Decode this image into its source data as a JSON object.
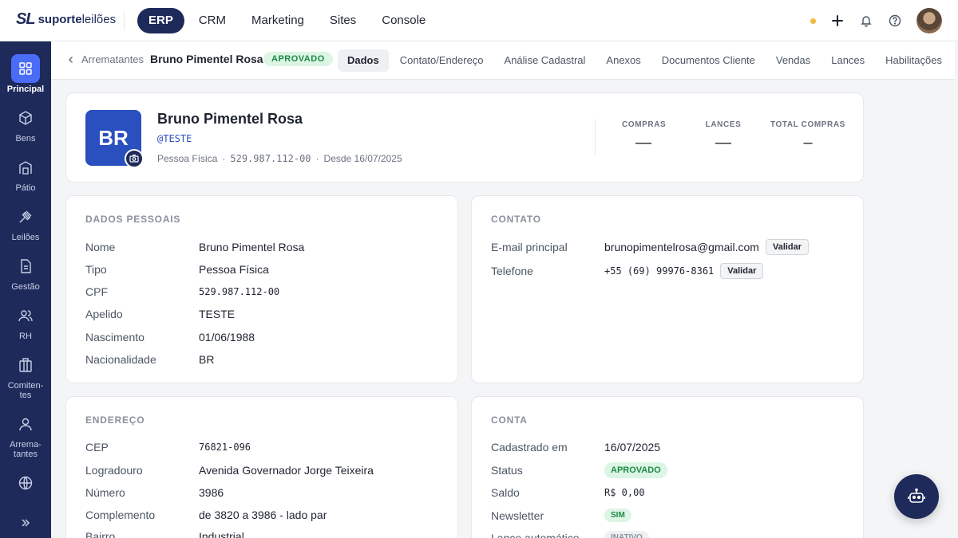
{
  "brand": {
    "mark": "SL",
    "name_bold": "suporte",
    "name_light": "leilões"
  },
  "topnav": [
    "ERP",
    "CRM",
    "Marketing",
    "Sites",
    "Console"
  ],
  "sidebar": [
    "Principal",
    "Bens",
    "Pátio",
    "Leilões",
    "Gestão",
    "RH",
    "Comiten-tes",
    "Arrema-tantes"
  ],
  "breadcrumb": {
    "parent": "Arrematantes",
    "current": "Bruno Pimentel Rosa",
    "status": "APROVADO"
  },
  "tabs": [
    "Dados",
    "Contato/Endereço",
    "Análise Cadastral",
    "Anexos",
    "Documentos Cliente",
    "Vendas",
    "Lances",
    "Habilitações"
  ],
  "profile": {
    "initials": "BR",
    "name": "Bruno Pimentel Rosa",
    "handle": "@TESTE",
    "type": "Pessoa Física",
    "cpf": "529.987.112-00",
    "since": "Desde 16/07/2025",
    "stats": [
      {
        "label": "COMPRAS",
        "value": "—"
      },
      {
        "label": "LANCES",
        "value": "—"
      },
      {
        "label": "TOTAL COMPRAS",
        "value": "–"
      }
    ]
  },
  "personal": {
    "title": "DADOS PESSOAIS",
    "rows": [
      {
        "k": "Nome",
        "v": "Bruno Pimentel Rosa"
      },
      {
        "k": "Tipo",
        "v": "Pessoa Física"
      },
      {
        "k": "CPF",
        "v": "529.987.112-00"
      },
      {
        "k": "Apelido",
        "v": "TESTE"
      },
      {
        "k": "Nascimento",
        "v": "01/06/1988"
      },
      {
        "k": "Nacionalidade",
        "v": "BR"
      }
    ]
  },
  "contact": {
    "title": "CONTATO",
    "email_label": "E-mail principal",
    "email": "brunopimentelrosa@gmail.com",
    "phone_label": "Telefone",
    "phone": "+55 (69) 99976-8361",
    "validate": "Validar"
  },
  "address": {
    "title": "ENDEREÇO",
    "rows": [
      {
        "k": "CEP",
        "v": "76821-096"
      },
      {
        "k": "Logradouro",
        "v": "Avenida Governador Jorge Teixeira"
      },
      {
        "k": "Número",
        "v": "3986"
      },
      {
        "k": "Complemento",
        "v": "de 3820 a 3986 - lado par"
      },
      {
        "k": "Bairro",
        "v": "Industrial"
      }
    ]
  },
  "account": {
    "title": "CONTA",
    "created_label": "Cadastrado em",
    "created": "16/07/2025",
    "status_label": "Status",
    "status": "APROVADO",
    "balance_label": "Saldo",
    "balance": "R$ 0,00",
    "newsletter_label": "Newsletter",
    "newsletter": "SIM",
    "auto_bid_label": "Lance automático",
    "auto_bid": "INATIVO"
  }
}
